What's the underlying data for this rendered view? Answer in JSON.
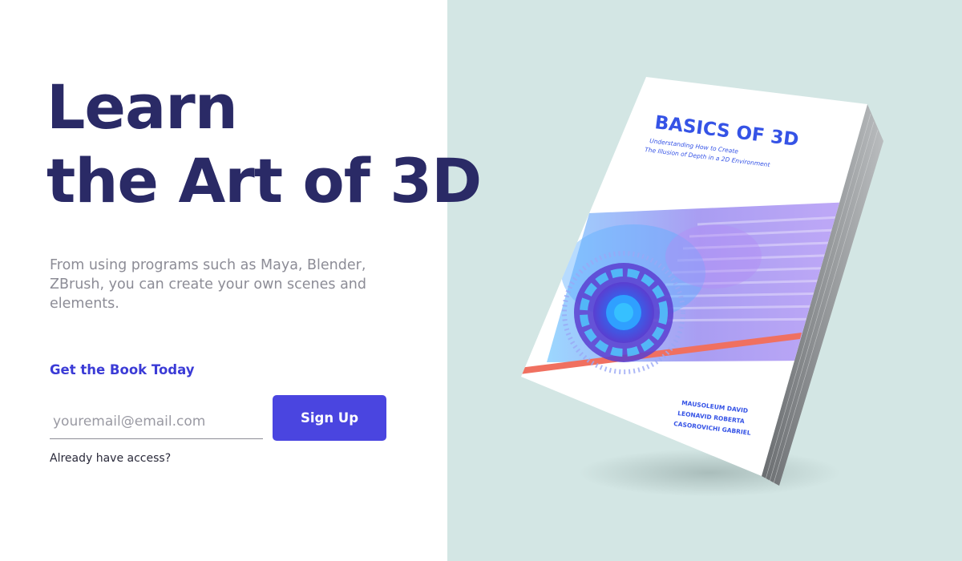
{
  "hero": {
    "headline_line1": "Learn",
    "headline_line2": "the Art of 3D",
    "description": "From using programs such as Maya, Blender, ZBrush, you can create your own scenes and elements."
  },
  "signup": {
    "cta_title": "Get the Book Today",
    "email_placeholder": "youremail@email.com",
    "button_label": "Sign Up",
    "existing_link": "Already have access?"
  },
  "book": {
    "title": "BASICS OF 3D",
    "subtitle_line1": "Understanding How to Create",
    "subtitle_line2": "The Illusion of Depth in a 2D Environment",
    "authors": [
      "MAUSOLEUM DAVID",
      "LEONAVID ROBERTA",
      "CASOROVICHI GABRIEL"
    ]
  },
  "colors": {
    "headline": "#2a2a66",
    "accent": "#4a45e0",
    "right_panel_bg": "#d3e6e4",
    "stripe": "#f07060"
  }
}
